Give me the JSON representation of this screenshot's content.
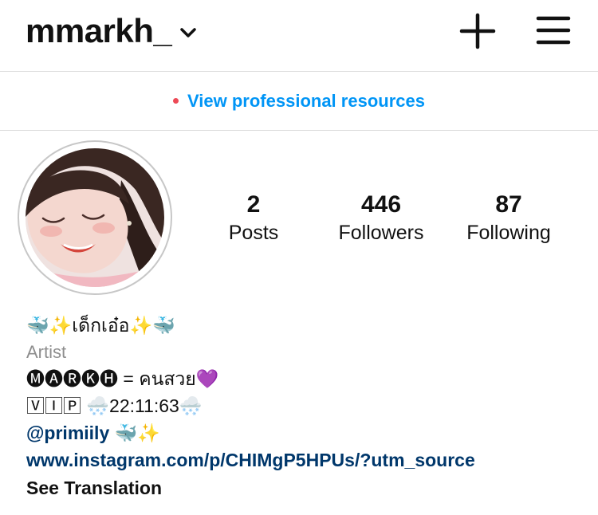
{
  "header": {
    "username": "mmarkh_",
    "icons": {
      "switch": "chevron-down-icon",
      "create": "plus-icon",
      "menu": "hamburger-menu-icon"
    }
  },
  "professional": {
    "label": "View professional resources",
    "dot_color": "#ed4956",
    "link_color": "#0095f6"
  },
  "profile": {
    "avatar": "profile-photo",
    "stats": [
      {
        "value": "2",
        "label": "Posts"
      },
      {
        "value": "446",
        "label": "Followers"
      },
      {
        "value": "87",
        "label": "Following"
      }
    ]
  },
  "bio": {
    "display_name": "🐳✨เด็กเอ๋อ✨🐳",
    "category": "Artist",
    "lines": [
      "🅜🅐🅡🅚🅗 = คนสวย💜",
      "🅅🄸🄿 🌨️22:11:63🌨️"
    ],
    "mention": "@primiily",
    "mention_suffix": " 🐳✨",
    "website": "www.instagram.com/p/CHIMgP5HPUs/?utm_source",
    "see_translation": "See Translation",
    "category_color": "#8e8e8e",
    "link_color": "#00376b"
  }
}
